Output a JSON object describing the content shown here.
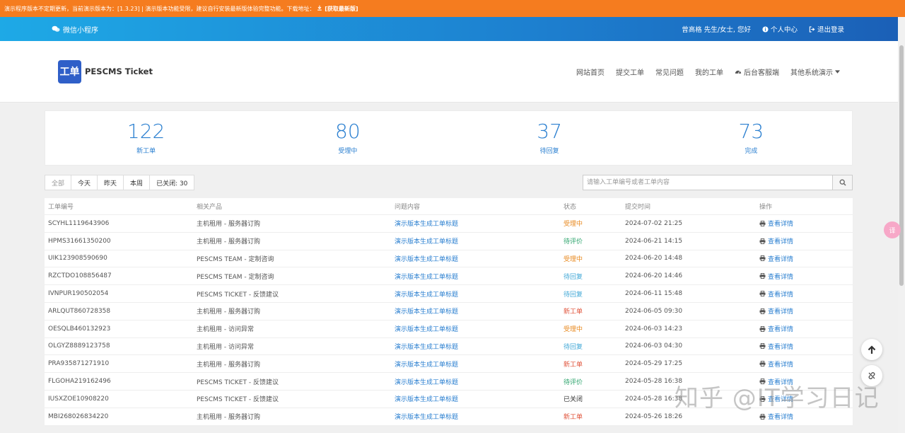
{
  "notice": {
    "text": "演示程序版本不定期更新，当前演示版本为：[1.3.23] | 演示版本功能受限，建议自行安装最新版体验完整功能。下载地址：",
    "link": "[获取最新版]"
  },
  "topbar": {
    "miniprogram": "微信小程序",
    "greeting": "曾高格 先生/女士, 您好",
    "profile": "个人中心",
    "logout": "退出登录"
  },
  "brand": {
    "logo_text": "工单",
    "name": "PESCMS Ticket"
  },
  "nav": {
    "home": "网站首页",
    "submit": "提交工单",
    "faq": "常见问题",
    "mine": "我的工单",
    "backend": "后台客服端",
    "others": "其他系统演示"
  },
  "stats": [
    {
      "value": "122",
      "label": "新工单"
    },
    {
      "value": "80",
      "label": "受理中"
    },
    {
      "value": "37",
      "label": "待回复"
    },
    {
      "value": "73",
      "label": "完成"
    }
  ],
  "filters": {
    "all": "全部",
    "today": "今天",
    "yesterday": "昨天",
    "week": "本周",
    "closed": "已关闭: 30"
  },
  "search": {
    "placeholder": "请输入工单编号或者工单内容"
  },
  "table": {
    "headers": [
      "工单编号",
      "相关产品",
      "问题内容",
      "状态",
      "提交时间",
      "操作"
    ],
    "rows": [
      {
        "id": "SCYHL1119643906",
        "product": "主机租用 - 服务器订购",
        "content": "演示版本生成工单标题",
        "status": "受理中",
        "status_color": "#e8891f",
        "time": "2024-07-02 21:25",
        "action": "查看详情"
      },
      {
        "id": "HPMS31661350200",
        "product": "主机租用 - 服务器订购",
        "content": "演示版本生成工单标题",
        "status": "待评价",
        "status_color": "#2ba36b",
        "time": "2024-06-21 14:15",
        "action": "查看详情"
      },
      {
        "id": "UIK123908590690",
        "product": "PESCMS TEAM - 定制咨询",
        "content": "演示版本生成工单标题",
        "status": "受理中",
        "status_color": "#e8891f",
        "time": "2024-06-20 14:48",
        "action": "查看详情"
      },
      {
        "id": "RZCTDO108856487",
        "product": "PESCMS TEAM - 定制咨询",
        "content": "演示版本生成工单标题",
        "status": "待回复",
        "status_color": "#3fa7d6",
        "time": "2024-06-20 14:46",
        "action": "查看详情"
      },
      {
        "id": "IVNPUR190502054",
        "product": "PESCMS TICKET - 反馈建议",
        "content": "演示版本生成工单标题",
        "status": "待回复",
        "status_color": "#3fa7d6",
        "time": "2024-06-11 15:48",
        "action": "查看详情"
      },
      {
        "id": "ARLQUT860728358",
        "product": "主机租用 - 服务器订购",
        "content": "演示版本生成工单标题",
        "status": "新工单",
        "status_color": "#e0533a",
        "time": "2024-06-05 09:30",
        "action": "查看详情"
      },
      {
        "id": "OESQLB460132923",
        "product": "主机租用 - 访问异常",
        "content": "演示版本生成工单标题",
        "status": "受理中",
        "status_color": "#e8891f",
        "time": "2024-06-03 14:23",
        "action": "查看详情"
      },
      {
        "id": "OLGYZ8889123758",
        "product": "主机租用 - 访问异常",
        "content": "演示版本生成工单标题",
        "status": "待回复",
        "status_color": "#3fa7d6",
        "time": "2024-06-03 04:30",
        "action": "查看详情"
      },
      {
        "id": "PRA935871271910",
        "product": "主机租用 - 服务器订购",
        "content": "演示版本生成工单标题",
        "status": "新工单",
        "status_color": "#e0533a",
        "time": "2024-05-29 17:25",
        "action": "查看详情"
      },
      {
        "id": "FLGOHA219162496",
        "product": "PESCMS TICKET - 反馈建议",
        "content": "演示版本生成工单标题",
        "status": "待评价",
        "status_color": "#2ba36b",
        "time": "2024-05-28 16:38",
        "action": "查看详情"
      },
      {
        "id": "IUSXZOE10908220",
        "product": "PESCMS TICKET - 反馈建议",
        "content": "演示版本生成工单标题",
        "status": "已关闭",
        "status_color": "#333333",
        "time": "2024-05-28 16:38",
        "action": "查看详情"
      },
      {
        "id": "MBI268026834220",
        "product": "主机租用 - 服务器订购",
        "content": "演示版本生成工单标题",
        "status": "新工单",
        "status_color": "#e0533a",
        "time": "2024-05-26 18:26",
        "action": "查看详情"
      }
    ]
  },
  "watermark": "知乎 @IT学习日记",
  "pink_badge": "译",
  "colors": {
    "notice": "#f57c1f",
    "accent": "#2a7fd0",
    "logo": "#2f5fc8"
  },
  "icons": [
    "wechat-icon",
    "info-circle-icon",
    "logout-icon",
    "dashboard-icon",
    "caret-down-icon",
    "search-icon",
    "print-icon",
    "arrow-up-icon",
    "link-broken-icon"
  ]
}
